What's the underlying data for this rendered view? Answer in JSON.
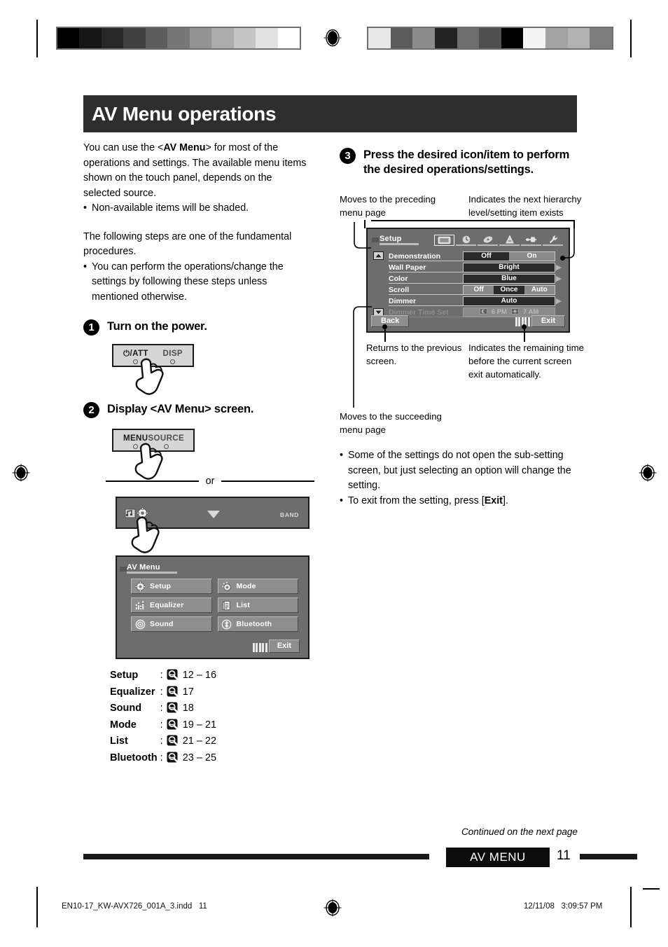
{
  "document": {
    "title": "AV Menu operations"
  },
  "left_column": {
    "intro_1_a": "You can use the <",
    "intro_1_b": "AV Menu",
    "intro_1_c": "> for most of the operations and settings. The available menu items shown on the touch panel, depends on the selected source.",
    "intro_bullet_1": "Non-available items will be shaded.",
    "intro_2": "The following steps are one of the fundamental procedures.",
    "intro_bullet_2": "You can perform the operations/change the settings by following these steps unless mentioned otherwise.",
    "bullet_char": "•"
  },
  "steps": [
    {
      "number": "1",
      "title": "Turn on the power."
    },
    {
      "number": "2",
      "title": "Display <AV Menu> screen."
    },
    {
      "number": "3",
      "title": "Press the desired icon/item to perform the desired operations/settings."
    }
  ],
  "hardware": {
    "power_button": {
      "left_key": "⏻/ATT",
      "right_key": "DISP"
    },
    "menu_button": {
      "left_key": "MENU",
      "right_key": "SOURCE"
    }
  },
  "or_divider": {
    "label": "or"
  },
  "source_bar": {
    "band_label": "BAND",
    "triangle_icon": "down-triangle-icon",
    "av_icon": "av-source-icon",
    "gear_icon": "gear-icon"
  },
  "av_menu_panel": {
    "title": "AV Menu",
    "items": [
      {
        "label": "Setup",
        "icon": "gear-icon"
      },
      {
        "label": "Mode",
        "icon": "mode-icon"
      },
      {
        "label": "Equalizer",
        "icon": "equalizer-icon"
      },
      {
        "label": "List",
        "icon": "list-icon"
      },
      {
        "label": "Sound",
        "icon": "sound-icon"
      },
      {
        "label": "Bluetooth",
        "icon": "bluetooth-icon"
      }
    ],
    "exit_label": "Exit",
    "timer_icon": "timer-bars-icon"
  },
  "reference_list": {
    "separator": ":",
    "page_icon": "magnifier-icon",
    "rows": [
      {
        "name": "Setup",
        "pages": "12 – 16"
      },
      {
        "name": "Equalizer",
        "pages": "17"
      },
      {
        "name": "Sound",
        "pages": "18"
      },
      {
        "name": "Mode",
        "pages": "19 – 21"
      },
      {
        "name": "List",
        "pages": "21 – 22"
      },
      {
        "name": "Bluetooth",
        "pages": "23 – 25"
      }
    ]
  },
  "setup_screen": {
    "title": "Setup",
    "tabs": [
      {
        "icon": "display-tab-icon",
        "selected": true
      },
      {
        "icon": "clock-tab-icon",
        "selected": false
      },
      {
        "icon": "audio-tab-icon",
        "selected": false
      },
      {
        "icon": "language-tab-icon",
        "selected": false
      },
      {
        "icon": "tuner-tab-icon",
        "selected": false
      },
      {
        "icon": "wrench-tab-icon",
        "selected": false
      }
    ],
    "rows": [
      {
        "label": "Demonstration",
        "dim": false,
        "type": "segments",
        "options": [
          {
            "text": "Off",
            "selected": true
          },
          {
            "text": "On",
            "selected": false
          }
        ],
        "arrow": false
      },
      {
        "label": "Wall Paper",
        "dim": false,
        "type": "single",
        "options": [
          {
            "text": "Bright",
            "selected": true
          }
        ],
        "arrow": true
      },
      {
        "label": "Color",
        "dim": false,
        "type": "single",
        "options": [
          {
            "text": "Blue",
            "selected": true
          }
        ],
        "arrow": true
      },
      {
        "label": "Scroll",
        "dim": false,
        "type": "segments",
        "options": [
          {
            "text": "Off",
            "selected": false
          },
          {
            "text": "Once",
            "selected": true
          },
          {
            "text": "Auto",
            "selected": false
          }
        ],
        "arrow": false
      },
      {
        "label": "Dimmer",
        "dim": false,
        "type": "single",
        "options": [
          {
            "text": "Auto",
            "selected": true
          }
        ],
        "arrow": true
      },
      {
        "label": "Dimmer Time Set",
        "dim": true,
        "type": "time",
        "time_on": "6 PM",
        "time_off": "7 AM",
        "arrow": false
      }
    ],
    "back_label": "Back",
    "exit_label": "Exit",
    "scroll_up_icon": "scroll-up-icon",
    "scroll_down_icon": "scroll-down-icon"
  },
  "callouts": {
    "preceding": "Moves to the preceding menu page",
    "hierarchy": "Indicates the next hierarchy level/setting item exists",
    "back": "Returns to the previous screen.",
    "remaining": "Indicates the remaining time before the current screen exit automatically.",
    "succeeding": "Moves to the succeeding menu page"
  },
  "right_notes": {
    "bullet_char": "•",
    "note_1": "Some of the settings do not open the sub-setting screen, but just selecting an option will change the setting.",
    "note_2_a": "To exit from the setting, press [",
    "note_2_b": "Exit",
    "note_2_c": "]."
  },
  "footer": {
    "continued": "Continued on the next page",
    "section": "AV MENU",
    "page_number": "11",
    "file_name": "EN10-17_KW-AVX726_001A_3.indd",
    "file_page": "11",
    "date": "12/11/08",
    "time": "3:09:57 PM"
  },
  "calibration": {
    "left_strip": [
      "#000000",
      "#161616",
      "#282828",
      "#414141",
      "#5d5d5d",
      "#777777",
      "#949494",
      "#acacac",
      "#c5c5c5",
      "#e2e2e2",
      "#ffffff"
    ],
    "right_strip": [
      "#e8e8e8",
      "#5a5a5a",
      "#8c8c8c",
      "#242424",
      "#6e6e6e",
      "#4f4f4f",
      "#000000",
      "#f4f4f4",
      "#a3a3a3",
      "#b2b2b2",
      "#7d7d7d"
    ]
  }
}
